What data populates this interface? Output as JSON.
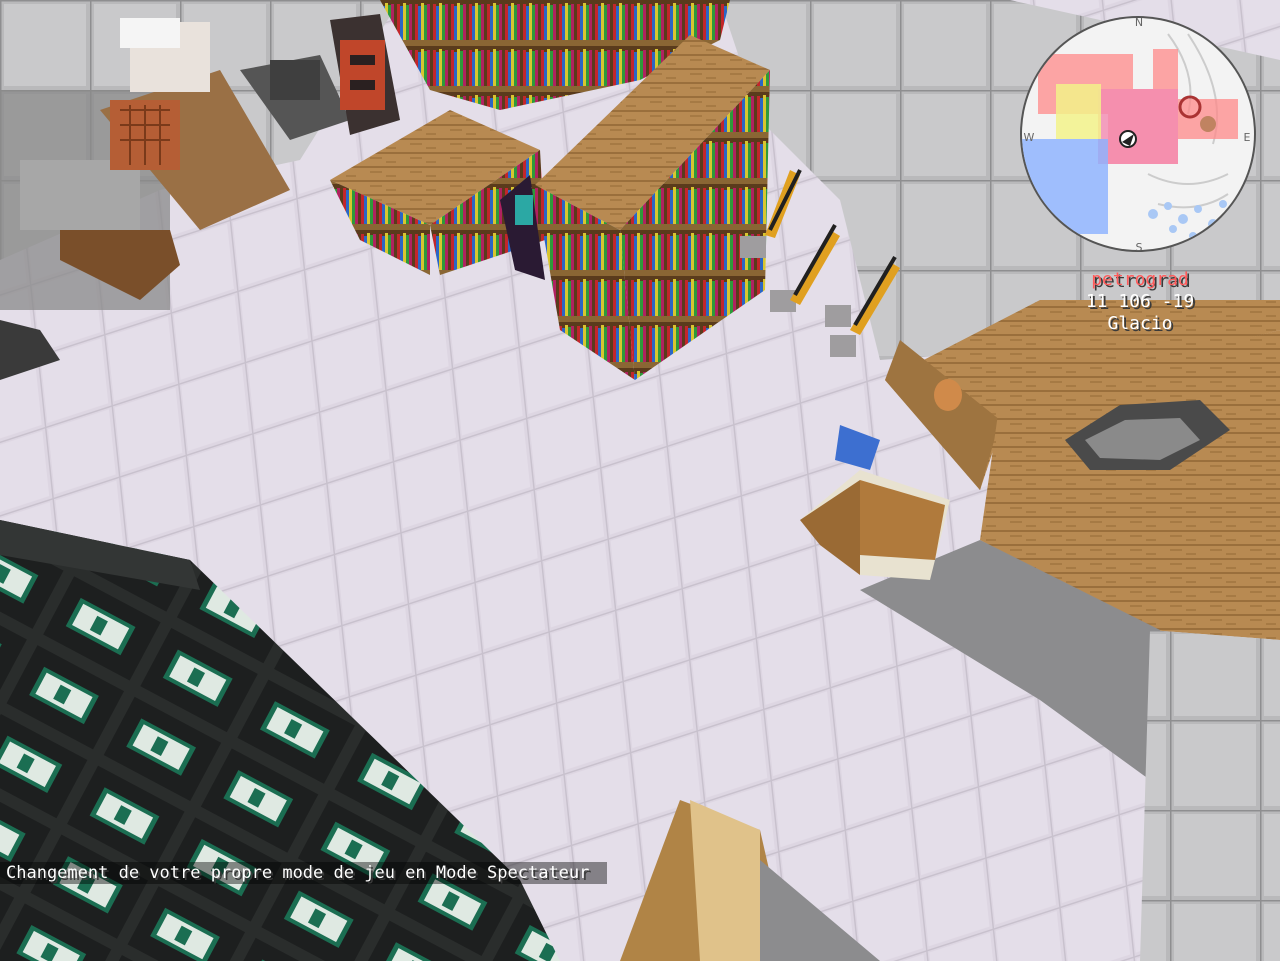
{
  "hud": {
    "location_name": "petrograd",
    "coordinates": "11 106 -19",
    "dimension": "Glacio",
    "minimap": {
      "compass": {
        "north": "N",
        "east": "E",
        "south": "S",
        "west": "W"
      }
    }
  },
  "chat": {
    "message": "Changement de votre propre mode de jeu en Mode Spectateur"
  },
  "colors": {
    "location_text": "#ff5a5a",
    "hud_text": "#ffffff",
    "floor_tile": "#e4dfe4",
    "claim_red": "#ff8a8a",
    "claim_pink": "#f28ab0",
    "claim_yellow": "#f2f28a",
    "claim_blue": "#8ab0ff"
  }
}
